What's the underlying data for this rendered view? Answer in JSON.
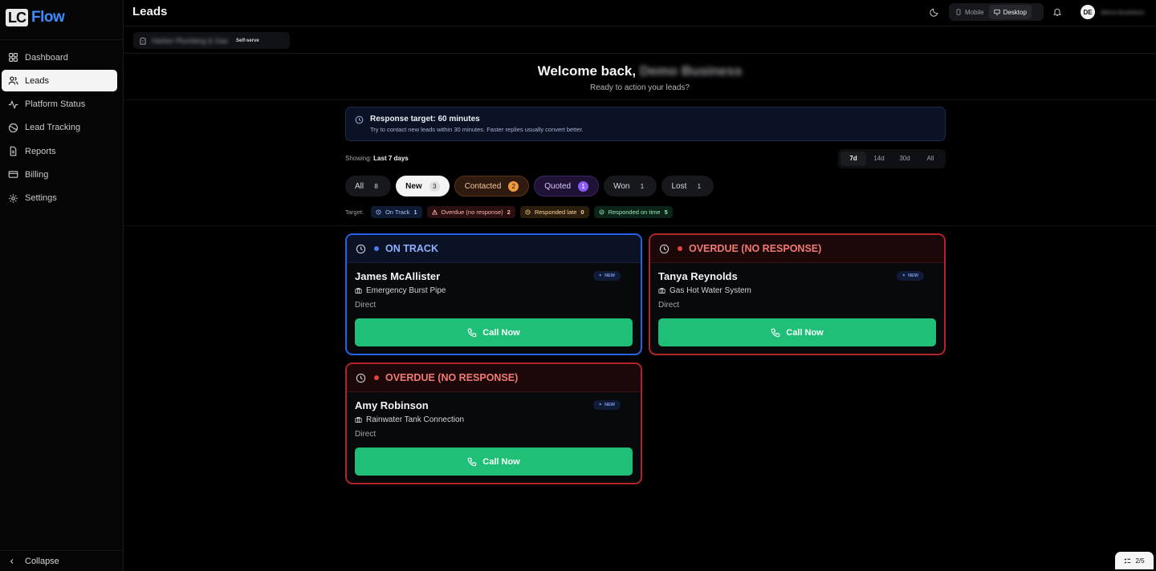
{
  "app": {
    "logo_mark": "LC",
    "logo_text": "Flow"
  },
  "sidebar": {
    "items": [
      {
        "label": "Dashboard",
        "icon": "grid-icon"
      },
      {
        "label": "Leads",
        "icon": "users-icon",
        "active": true
      },
      {
        "label": "Platform Status",
        "icon": "activity-icon"
      },
      {
        "label": "Lead Tracking",
        "icon": "target-icon"
      },
      {
        "label": "Reports",
        "icon": "file-text-icon"
      },
      {
        "label": "Billing",
        "icon": "credit-card-icon"
      },
      {
        "label": "Settings",
        "icon": "gear-icon"
      }
    ],
    "collapse_label": "Collapse"
  },
  "header": {
    "title": "Leads",
    "view_toggle": {
      "mobile": "Mobile",
      "desktop": "Desktop",
      "selected": "Desktop"
    },
    "avatar_initials": "DE",
    "user_name": "demo-business"
  },
  "business": {
    "name": "Harbor Plumbing & Gas",
    "tag": "Self-serve"
  },
  "welcome": {
    "title": "Welcome back,",
    "name": "Demo Business",
    "subtitle": "Ready to action your leads?"
  },
  "banner": {
    "title": "Response target: 60 minutes",
    "text": "Try to contact new leads within 30 minutes. Faster replies usually convert better."
  },
  "showing": {
    "label": "Showing:",
    "value": "Last 7 days"
  },
  "ranges": [
    "7d",
    "14d",
    "30d",
    "All"
  ],
  "ranges_selected": "7d",
  "tabs": [
    {
      "label": "All",
      "count": "8"
    },
    {
      "label": "New",
      "count": "3",
      "selected": true
    },
    {
      "label": "Contacted",
      "count": "2"
    },
    {
      "label": "Quoted",
      "count": "1"
    },
    {
      "label": "Won",
      "count": "1"
    },
    {
      "label": "Lost",
      "count": "1"
    }
  ],
  "targets": {
    "label": "Target:",
    "chips": [
      {
        "label": "On Track",
        "count": "1"
      },
      {
        "label": "Overdue (no response)",
        "count": "2"
      },
      {
        "label": "Responded late",
        "count": "0"
      },
      {
        "label": "Responded on time",
        "count": "5"
      }
    ]
  },
  "leads": [
    {
      "status": "ON TRACK",
      "name": "James McAllister",
      "badge": "NEW",
      "job": "Emergency Burst Pipe",
      "source": "Direct",
      "cta": "Call Now",
      "status_color": "#2563eb"
    },
    {
      "status": "OVERDUE (NO RESPONSE)",
      "name": "Tanya Reynolds",
      "badge": "NEW",
      "job": "Gas Hot Water System",
      "source": "Direct",
      "cta": "Call Now",
      "status_color": "#b3242a"
    },
    {
      "status": "OVERDUE (NO RESPONSE)",
      "name": "Amy Robinson",
      "badge": "NEW",
      "job": "Rainwater Tank Connection",
      "source": "Direct",
      "cta": "Call Now",
      "status_color": "#b3242a"
    }
  ],
  "pager": {
    "text": "2/5"
  },
  "colors": {
    "accent": "#3b8cff",
    "call_green": "#1fbf78",
    "on_track_blue": "#2563eb",
    "overdue_red": "#b3242a"
  }
}
